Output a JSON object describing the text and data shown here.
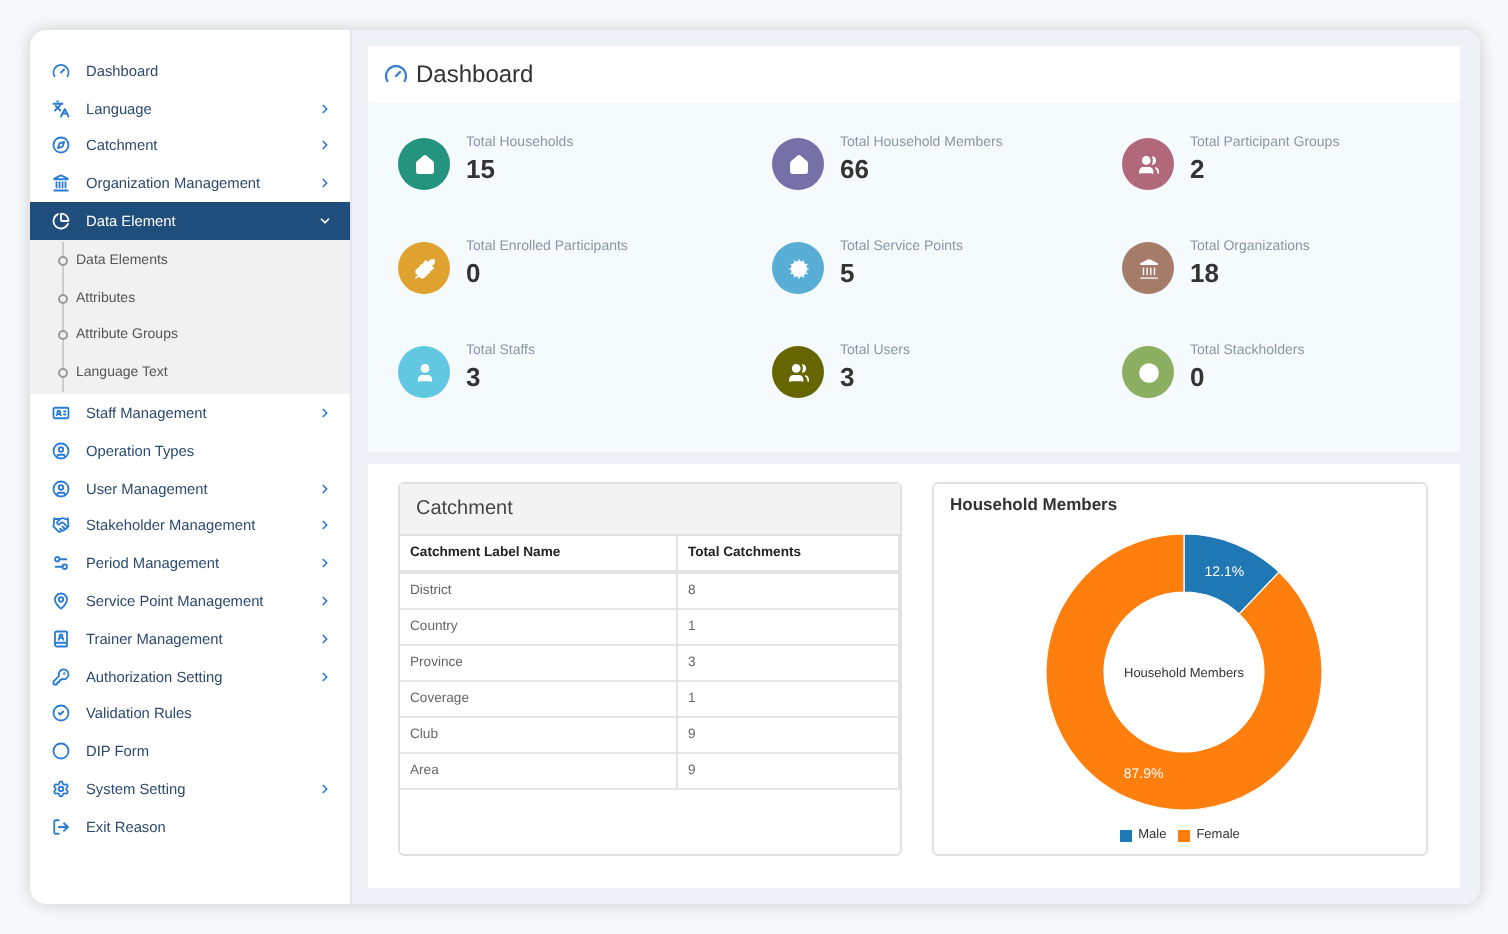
{
  "sidebar": {
    "items": [
      {
        "label": "Dashboard",
        "has_arrow": false,
        "selected": false
      },
      {
        "label": "Language",
        "has_arrow": true,
        "selected": false,
        "expanded": false
      },
      {
        "label": "Catchment",
        "has_arrow": true,
        "selected": false,
        "expanded": false
      },
      {
        "label": "Organization Management",
        "has_arrow": true,
        "selected": false,
        "expanded": false
      },
      {
        "label": "Data Element",
        "has_arrow": true,
        "selected": true,
        "expanded": true,
        "children": [
          {
            "label": "Data Elements"
          },
          {
            "label": "Attributes"
          },
          {
            "label": "Attribute Groups"
          },
          {
            "label": "Language Text"
          }
        ]
      },
      {
        "label": "Staff Management",
        "has_arrow": true,
        "selected": false,
        "expanded": false
      },
      {
        "label": "Operation Types",
        "has_arrow": false,
        "selected": false
      },
      {
        "label": "User Management",
        "has_arrow": true,
        "selected": false,
        "expanded": false
      },
      {
        "label": "Stakeholder Management",
        "has_arrow": true,
        "selected": false,
        "expanded": false
      },
      {
        "label": "Period Management",
        "has_arrow": true,
        "selected": false,
        "expanded": false
      },
      {
        "label": "Service Point Management",
        "has_arrow": true,
        "selected": false,
        "expanded": false
      },
      {
        "label": "Trainer Management",
        "has_arrow": true,
        "selected": false,
        "expanded": false
      },
      {
        "label": "Authorization Setting",
        "has_arrow": true,
        "selected": false,
        "expanded": false
      },
      {
        "label": "Validation Rules",
        "has_arrow": false,
        "selected": false
      },
      {
        "label": "DIP Form",
        "has_arrow": false,
        "selected": false
      },
      {
        "label": "System Setting",
        "has_arrow": true,
        "selected": false,
        "expanded": false
      },
      {
        "label": "Exit Reason",
        "has_arrow": false,
        "selected": false
      }
    ]
  },
  "header": {
    "title": "Dashboard"
  },
  "stats": [
    {
      "label": "Total Households",
      "value": "15",
      "color": "#24947f"
    },
    {
      "label": "Total Household Members",
      "value": "66",
      "color": "#7570a8"
    },
    {
      "label": "Total Participant Groups",
      "value": "2",
      "color": "#b0687a"
    },
    {
      "label": "Total Enrolled Participants",
      "value": "0",
      "color": "#e0a22e"
    },
    {
      "label": "Total Service Points",
      "value": "5",
      "color": "#59aed6"
    },
    {
      "label": "Total Organizations",
      "value": "18",
      "color": "#a57c6a"
    },
    {
      "label": "Total Staffs",
      "value": "3",
      "color": "#62c8e2"
    },
    {
      "label": "Total Users",
      "value": "3",
      "color": "#666600"
    },
    {
      "label": "Total Stackholders",
      "value": "0",
      "color": "#8cae60"
    }
  ],
  "catchment": {
    "title": "Catchment",
    "columns": [
      "Catchment Label Name",
      "Total Catchments"
    ],
    "rows": [
      [
        "District",
        "8"
      ],
      [
        "Country",
        "1"
      ],
      [
        "Province",
        "3"
      ],
      [
        "Coverage",
        "1"
      ],
      [
        "Club",
        "9"
      ],
      [
        "Area",
        "9"
      ]
    ]
  },
  "chart": {
    "title": "Household Members",
    "chart_data": {
      "type": "donut",
      "categories": [
        "Male",
        "Female"
      ],
      "series": [
        {
          "name": "Household Members",
          "values": [
            12.1,
            87.9
          ]
        }
      ],
      "colors": [
        "#1f77b4",
        "#ff7f0e"
      ],
      "value_labels": [
        "12.1%",
        "87.9%"
      ]
    }
  }
}
